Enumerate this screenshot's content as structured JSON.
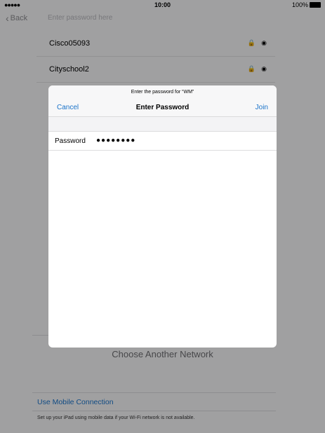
{
  "status": {
    "signal": "●●●●●",
    "time": "10:00",
    "battery_percent": "100%"
  },
  "nav": {
    "back_label": "Back",
    "title": "Enter password here"
  },
  "networks": [
    {
      "name": "Cisco05093"
    },
    {
      "name": "Cityschool2"
    }
  ],
  "icons": {
    "lock": "🔒",
    "wifi": "◉"
  },
  "choose_another": "Choose Another Network",
  "mobile": {
    "link": "Use Mobile Connection",
    "note": "Set up your iPad using mobile data if your Wi-Fi network is not available."
  },
  "dialog": {
    "prompt": "Enter the password for “WM”",
    "title": "Enter Password",
    "cancel": "Cancel",
    "join": "Join",
    "password_label": "Password",
    "password_value": "●●●●●●●●"
  },
  "colors": {
    "accent": "#1a73c9"
  }
}
